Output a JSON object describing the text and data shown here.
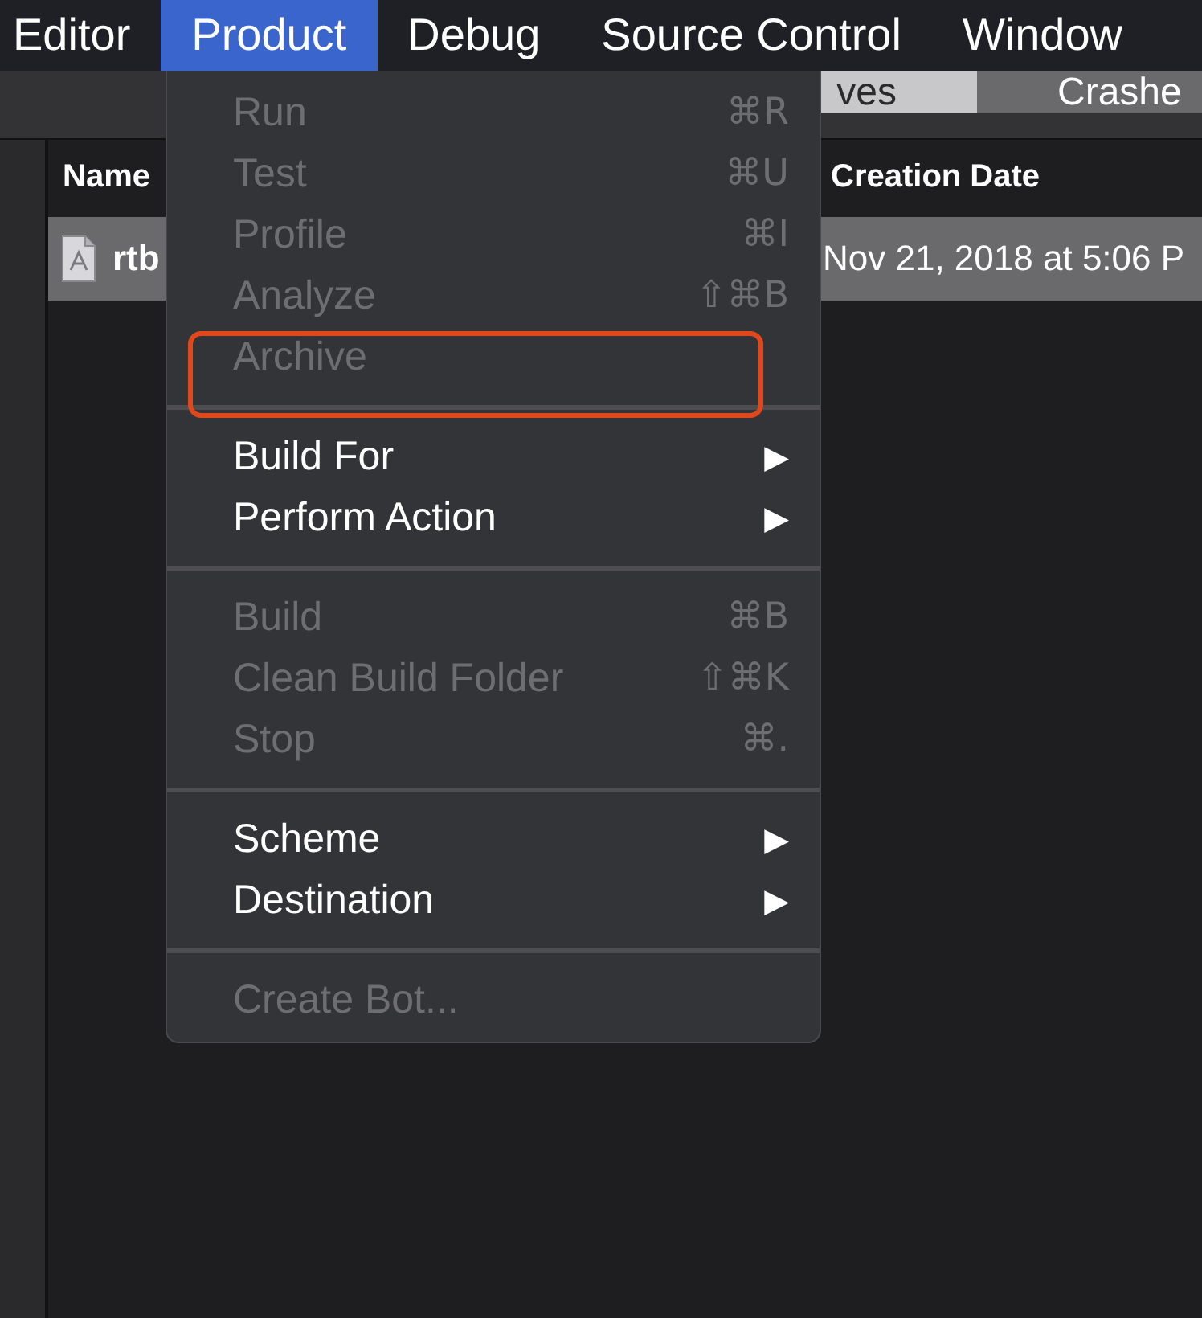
{
  "menubar": [
    {
      "label": "Editor",
      "selected": false
    },
    {
      "label": "Product",
      "selected": true
    },
    {
      "label": "Debug",
      "selected": false
    },
    {
      "label": "Source Control",
      "selected": false
    },
    {
      "label": "Window",
      "selected": false
    }
  ],
  "tabs": [
    {
      "label": "ves",
      "selected": true
    },
    {
      "label": "Crashe",
      "selected": false
    }
  ],
  "table": {
    "columns": [
      "Name",
      "Creation Date"
    ],
    "rows": [
      {
        "selected": true,
        "cells": [
          "rtb",
          "Nov 21, 2018 at 5:06 P"
        ]
      }
    ]
  },
  "menu": {
    "items": [
      {
        "kind": "item",
        "label": "Run",
        "shortcut": "⌘R",
        "disabled": true,
        "highlighted": false
      },
      {
        "kind": "item",
        "label": "Test",
        "shortcut": "⌘U",
        "disabled": true,
        "highlighted": false
      },
      {
        "kind": "item",
        "label": "Profile",
        "shortcut": "⌘I",
        "disabled": true,
        "highlighted": false
      },
      {
        "kind": "item",
        "label": "Analyze",
        "shortcut": "⇧⌘B",
        "disabled": true,
        "highlighted": false
      },
      {
        "kind": "item",
        "label": "Archive",
        "disabled": true,
        "highlighted": true
      },
      {
        "kind": "separator"
      },
      {
        "kind": "submenu",
        "label": "Build For",
        "arrow": "▶",
        "disabled": false
      },
      {
        "kind": "submenu",
        "label": "Perform Action",
        "arrow": "▶",
        "disabled": false
      },
      {
        "kind": "separator"
      },
      {
        "kind": "item",
        "label": "Build",
        "shortcut": "⌘B",
        "disabled": true,
        "highlighted": false
      },
      {
        "kind": "item",
        "label": "Clean Build Folder",
        "shortcut": "⇧⌘K",
        "disabled": true,
        "highlighted": false
      },
      {
        "kind": "item",
        "label": "Stop",
        "shortcut": "⌘.",
        "disabled": true,
        "highlighted": false
      },
      {
        "kind": "separator"
      },
      {
        "kind": "submenu",
        "label": "Scheme",
        "arrow": "▶",
        "disabled": false
      },
      {
        "kind": "submenu",
        "label": "Destination",
        "arrow": "▶",
        "disabled": false
      },
      {
        "kind": "separator"
      },
      {
        "kind": "item",
        "label": "Create Bot...",
        "disabled": true,
        "highlighted": false
      }
    ]
  }
}
